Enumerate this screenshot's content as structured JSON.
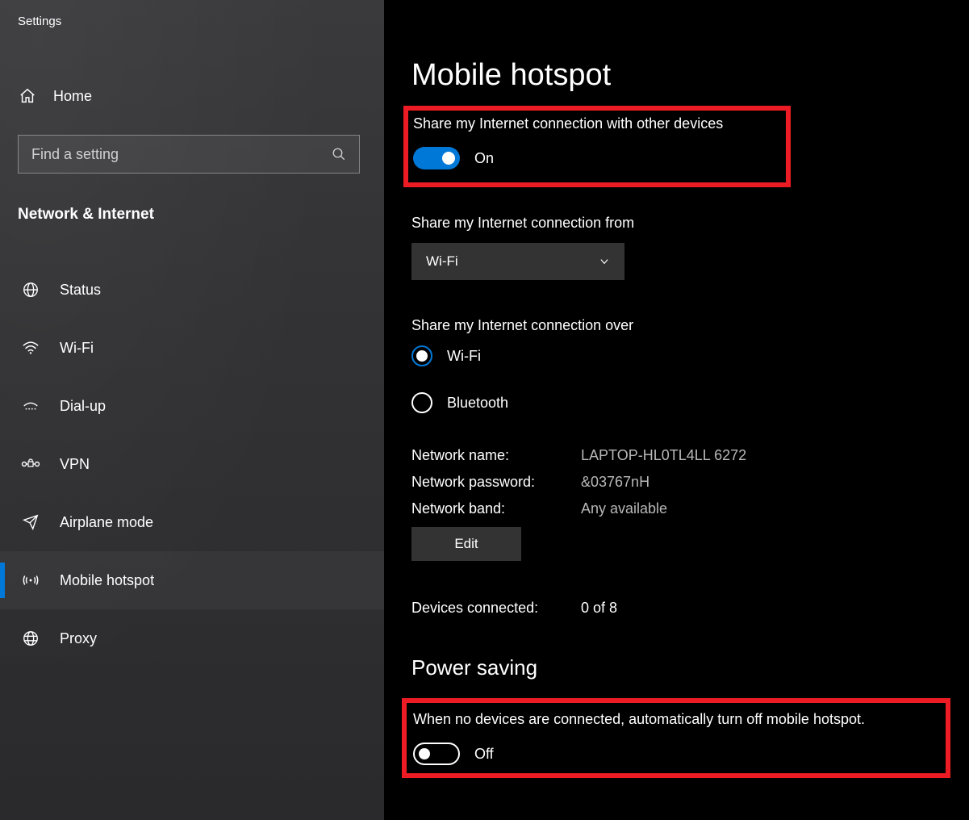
{
  "app_title": "Settings",
  "home_label": "Home",
  "search_placeholder": "Find a setting",
  "section_label": "Network & Internet",
  "nav_items": [
    {
      "label": "Status",
      "icon": "globe-icon",
      "active": false
    },
    {
      "label": "Wi-Fi",
      "icon": "wifi-icon",
      "active": false
    },
    {
      "label": "Dial-up",
      "icon": "dialup-icon",
      "active": false
    },
    {
      "label": "VPN",
      "icon": "vpn-icon",
      "active": false
    },
    {
      "label": "Airplane mode",
      "icon": "airplane-icon",
      "active": false
    },
    {
      "label": "Mobile hotspot",
      "icon": "hotspot-icon",
      "active": true
    },
    {
      "label": "Proxy",
      "icon": "proxy-icon",
      "active": false
    }
  ],
  "page_title": "Mobile hotspot",
  "share_toggle": {
    "label": "Share my Internet connection with other devices",
    "state_label": "On",
    "on": true
  },
  "share_from": {
    "label": "Share my Internet connection from",
    "selected": "Wi-Fi"
  },
  "share_over": {
    "label": "Share my Internet connection over",
    "options": [
      {
        "label": "Wi-Fi",
        "selected": true
      },
      {
        "label": "Bluetooth",
        "selected": false
      }
    ]
  },
  "network_info": {
    "name_label": "Network name:",
    "name_value": "LAPTOP-HL0TL4LL 6272",
    "password_label": "Network password:",
    "password_value": "&03767nH",
    "band_label": "Network band:",
    "band_value": "Any available",
    "edit_label": "Edit"
  },
  "devices_connected": {
    "label": "Devices connected:",
    "value": "0 of 8"
  },
  "power_saving": {
    "heading": "Power saving",
    "label": "When no devices are connected, automatically turn off mobile hotspot.",
    "state_label": "Off",
    "on": false
  },
  "colors": {
    "accent": "#0078d7",
    "highlight": "#ed1c24"
  }
}
